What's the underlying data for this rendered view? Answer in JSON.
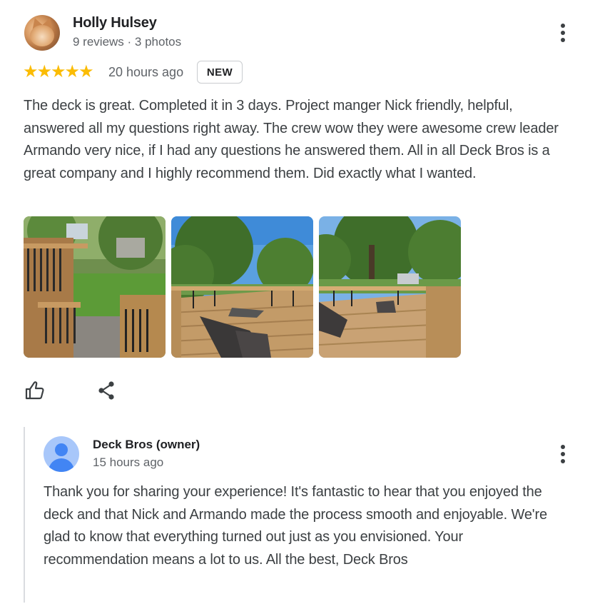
{
  "review": {
    "author": "Holly Hulsey",
    "author_meta": "9 reviews · 3 photos",
    "rating": 5,
    "stars": "★★★★★",
    "time": "20 hours ago",
    "badge": "NEW",
    "text": "The deck is great. Completed it in 3 days. Project manger Nick friendly, helpful, answered all my questions right away. The crew wow they were awesome crew leader Armando very nice, if I had any questions he answered them. All in all Deck Bros is a great company and I highly recommend them. Did exactly what I wanted.",
    "photos": [
      {
        "icon": "deck-stairs-photo"
      },
      {
        "icon": "deck-chair-photo"
      },
      {
        "icon": "deck-wide-photo"
      }
    ],
    "actions": {
      "like_icon": "thumbs-up-icon",
      "share_icon": "share-icon",
      "more_icon": "more-vert-icon"
    }
  },
  "owner_reply": {
    "name": "Deck Bros (owner)",
    "time": "15 hours ago",
    "text": "Thank you for sharing your experience! It's fantastic to hear that you enjoyed the deck and that Nick and Armando made the process smooth and enjoyable. We're glad to know that everything turned out just as you envisioned. Your recommendation means a lot to us. All the best, Deck Bros",
    "more_icon": "more-vert-icon"
  },
  "colors": {
    "star": "#fbbc04",
    "text_primary": "#202124",
    "text_secondary": "#5f6368",
    "owner_avatar_bg": "#a8c7fa",
    "owner_avatar_fg": "#4285f4"
  }
}
